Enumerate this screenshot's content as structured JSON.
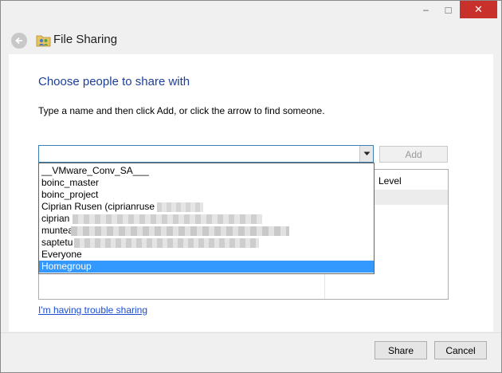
{
  "window": {
    "title": "File Sharing",
    "minimize_glyph": "–",
    "maximize_glyph": "□",
    "close_glyph": "✕"
  },
  "page": {
    "heading": "Choose people to share with",
    "instruction": "Type a name and then click Add, or click the arrow to find someone."
  },
  "name_input": {
    "value": ""
  },
  "add_button": {
    "label": "Add",
    "enabled": false
  },
  "table": {
    "column_level": "Level"
  },
  "dropdown": {
    "items": [
      {
        "label": "__VMware_Conv_SA___",
        "selected": false
      },
      {
        "label": "boinc_master",
        "selected": false
      },
      {
        "label": "boinc_project",
        "selected": false
      },
      {
        "label": "Ciprian Rusen (ciprianruse",
        "selected": false
      },
      {
        "label": "ciprian",
        "selected": false
      },
      {
        "label": "muntea",
        "selected": false
      },
      {
        "label": "saptetu",
        "selected": false
      },
      {
        "label": "Everyone",
        "selected": false
      },
      {
        "label": "Homegroup",
        "selected": true
      }
    ]
  },
  "help_link": "I'm having trouble sharing",
  "footer": {
    "share_label": "Share",
    "cancel_label": "Cancel"
  },
  "colors": {
    "heading": "#1c3f9a",
    "link": "#1c4ccf",
    "selection": "#3399ff",
    "close_button": "#c7302b",
    "input_border": "#3c7fb1"
  },
  "icons": {
    "back": "back-arrow-icon",
    "title": "share-folder-icon",
    "combo": "chevron-down-icon"
  }
}
